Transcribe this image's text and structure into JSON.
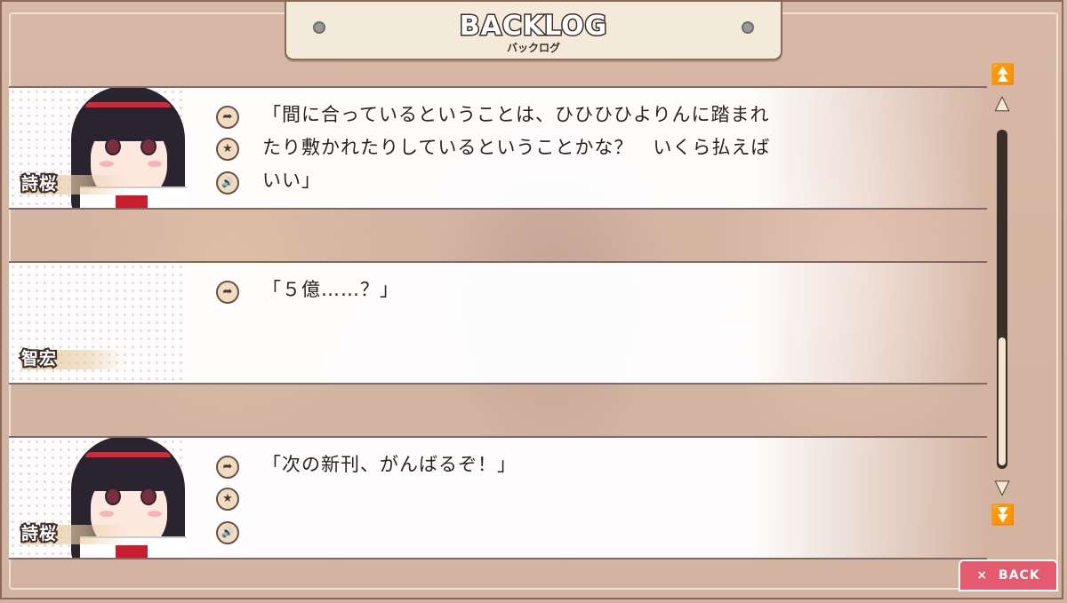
{
  "header": {
    "title": "BACKLOG",
    "subtitle": "バックログ"
  },
  "entries": [
    {
      "speaker": "詩桜",
      "text": "「間に合っているということは、ひひひひよりんに踏まれ\nたり敷かれたりしているということかな？　いくら払えば\nいい」",
      "buttons": [
        "jump-icon",
        "favorite-icon",
        "voice-icon"
      ]
    },
    {
      "speaker": "智宏",
      "text": "「５億……？」",
      "buttons": [
        "jump-icon"
      ]
    },
    {
      "speaker": "詩桜",
      "text": "「次の新刊、がんばるぞ！」",
      "buttons": [
        "jump-icon",
        "favorite-icon",
        "voice-icon"
      ]
    }
  ],
  "scrollbar": {
    "top_label": "⏫",
    "up_label": "▲",
    "down_label": "▼",
    "bottom_label": "⏬",
    "position": 0.95
  },
  "back_button": {
    "icon": "×",
    "label": "BACK"
  },
  "icons": {
    "jump": "➦",
    "favorite": "★",
    "voice": "🔊"
  },
  "colors": {
    "accent": "#e45a6f",
    "frame": "#8a6a55",
    "panel": "#f4ead9"
  }
}
